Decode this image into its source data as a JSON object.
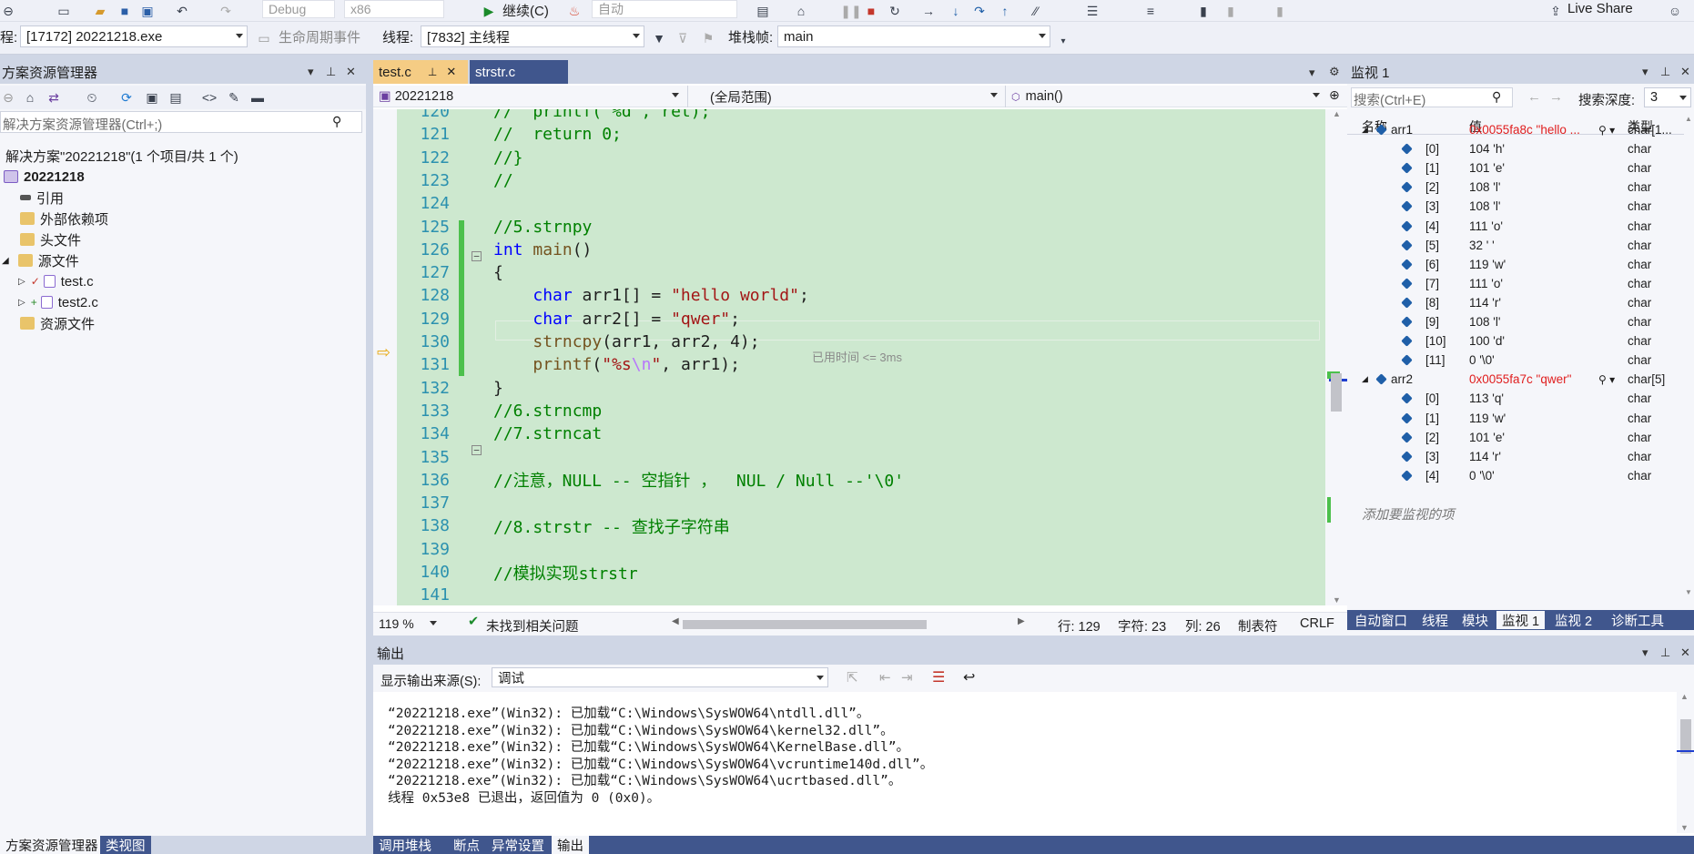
{
  "toolbar1": {
    "config": "Debug",
    "platform": "x86",
    "continue_label": "继续(C)",
    "auto_label": "自动",
    "live_share": "Live Share"
  },
  "toolbar2": {
    "process_label": "程:",
    "process_value": "[17172] 20221218.exe",
    "lifecycle_label": "生命周期事件",
    "thread_label": "线程:",
    "thread_value": "[7832] 主线程",
    "stack_label": "堆栈帧:",
    "stack_value": "main"
  },
  "solution_explorer": {
    "title": "方案资源管理器",
    "search_placeholder": "解决方案资源管理器(Ctrl+;)",
    "solution_line": "解决方案\"20221218\"(1 个项目/共 1 个)",
    "project": "20221218",
    "items": [
      "引用",
      "外部依赖项",
      "头文件",
      "源文件",
      "test.c",
      "test2.c",
      "资源文件"
    ],
    "bottom_tabs": [
      "方案资源管理器",
      "类视图"
    ]
  },
  "editor": {
    "tabs": [
      "test.c",
      "strstr.c"
    ],
    "nav_project": "20221218",
    "nav_scope": "(全局范围)",
    "nav_func": "main()",
    "lines": [
      {
        "n": "120",
        "html": "<span class=\"cm\">//  printf(\"%d\", ret);</span>"
      },
      {
        "n": "121",
        "html": "<span class=\"cm\">//  return 0;</span>"
      },
      {
        "n": "122",
        "html": "<span class=\"cm\">//}</span>"
      },
      {
        "n": "123",
        "html": "<span class=\"cm\">//</span>"
      },
      {
        "n": "124",
        "html": ""
      },
      {
        "n": "125",
        "html": "<span class=\"cm\">//5.strnpy</span>"
      },
      {
        "n": "126",
        "html": "<span class=\"kw\">int</span> <span class=\"fn\">main</span>()"
      },
      {
        "n": "127",
        "html": "{"
      },
      {
        "n": "128",
        "html": "    <span class=\"kw\">char</span> arr1[] = <span class=\"str\">\"hello world\"</span>;"
      },
      {
        "n": "129",
        "html": "    <span class=\"kw\">char</span> arr2[] = <span class=\"str\">\"qwer\"</span>;"
      },
      {
        "n": "130",
        "html": "    <span class=\"fn\">strncpy</span>(arr1, arr2, 4);"
      },
      {
        "n": "131",
        "html": "    <span class=\"fn\">printf</span>(<span class=\"str\">\"%s</span><span style=\"color:#b776fb\">\\n</span><span class=\"str\">\"</span>, arr1);"
      },
      {
        "n": "132",
        "html": "}"
      },
      {
        "n": "133",
        "html": "<span class=\"cm\">//6.strncmp</span>"
      },
      {
        "n": "134",
        "html": "<span class=\"cm\">//7.strncat</span>"
      },
      {
        "n": "135",
        "html": ""
      },
      {
        "n": "136",
        "html": "<span class=\"cm\">//注意，NULL -- 空指针 ，  NUL / Null --'\\0'</span>"
      },
      {
        "n": "137",
        "html": ""
      },
      {
        "n": "138",
        "html": "<span class=\"cm\">//8.strstr -- 查找子字符串</span>"
      },
      {
        "n": "139",
        "html": ""
      },
      {
        "n": "140",
        "html": "<span class=\"cm\">//模拟实现strstr</span>"
      },
      {
        "n": "141",
        "html": ""
      }
    ],
    "elapsed": "已用时间 <= 3ms",
    "status": {
      "zoom": "119 %",
      "issues": "未找到相关问题",
      "line": "行: 129",
      "char": "字符: 23",
      "col": "列: 26",
      "tabs": "制表符",
      "eol": "CRLF"
    }
  },
  "watch": {
    "title": "监视 1",
    "search_placeholder": "搜索(Ctrl+E)",
    "depth_label": "搜索深度:",
    "depth_value": "3",
    "headers": [
      "名称",
      "值",
      "类型"
    ],
    "rows": [
      {
        "name": "arr1",
        "value": "0x0055fa8c \"hello ...",
        "type": "char[1...",
        "level": 0,
        "red": true
      },
      {
        "name": "[0]",
        "value": "104 'h'",
        "type": "char",
        "level": 1
      },
      {
        "name": "[1]",
        "value": "101 'e'",
        "type": "char",
        "level": 1
      },
      {
        "name": "[2]",
        "value": "108 'l'",
        "type": "char",
        "level": 1
      },
      {
        "name": "[3]",
        "value": "108 'l'",
        "type": "char",
        "level": 1
      },
      {
        "name": "[4]",
        "value": "111 'o'",
        "type": "char",
        "level": 1
      },
      {
        "name": "[5]",
        "value": "32 ' '",
        "type": "char",
        "level": 1
      },
      {
        "name": "[6]",
        "value": "119 'w'",
        "type": "char",
        "level": 1
      },
      {
        "name": "[7]",
        "value": "111 'o'",
        "type": "char",
        "level": 1
      },
      {
        "name": "[8]",
        "value": "114 'r'",
        "type": "char",
        "level": 1
      },
      {
        "name": "[9]",
        "value": "108 'l'",
        "type": "char",
        "level": 1
      },
      {
        "name": "[10]",
        "value": "100 'd'",
        "type": "char",
        "level": 1
      },
      {
        "name": "[11]",
        "value": "0 '\\0'",
        "type": "char",
        "level": 1
      },
      {
        "name": "arr2",
        "value": "0x0055fa7c \"qwer\"",
        "type": "char[5]",
        "level": 0,
        "red": true
      },
      {
        "name": "[0]",
        "value": "113 'q'",
        "type": "char",
        "level": 1
      },
      {
        "name": "[1]",
        "value": "119 'w'",
        "type": "char",
        "level": 1
      },
      {
        "name": "[2]",
        "value": "101 'e'",
        "type": "char",
        "level": 1
      },
      {
        "name": "[3]",
        "value": "114 'r'",
        "type": "char",
        "level": 1
      },
      {
        "name": "[4]",
        "value": "0 '\\0'",
        "type": "char",
        "level": 1
      }
    ],
    "add_item": "添加要监视的项",
    "bottom_tabs": [
      "自动窗口",
      "线程",
      "模块",
      "监视 1",
      "监视 2",
      "诊断工具"
    ]
  },
  "output": {
    "title": "输出",
    "source_label": "显示输出来源(S):",
    "source_value": "调试",
    "lines": [
      "“20221218.exe”(Win32): 已加载“C:\\Windows\\SysWOW64\\ntdll.dll”。",
      "“20221218.exe”(Win32): 已加载“C:\\Windows\\SysWOW64\\kernel32.dll”。",
      "“20221218.exe”(Win32): 已加载“C:\\Windows\\SysWOW64\\KernelBase.dll”。",
      "“20221218.exe”(Win32): 已加载“C:\\Windows\\SysWOW64\\vcruntime140d.dll”。",
      "“20221218.exe”(Win32): 已加载“C:\\Windows\\SysWOW64\\ucrtbased.dll”。",
      "线程 0x53e8 已退出，返回值为 0 (0x0)。"
    ],
    "bottom_tabs": [
      "调用堆栈",
      "断点",
      "异常设置",
      "输出"
    ]
  }
}
